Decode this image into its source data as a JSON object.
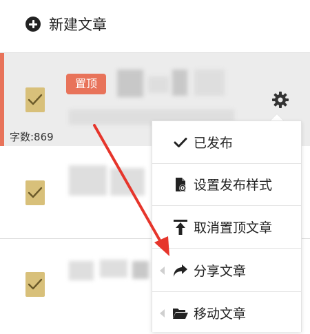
{
  "header": {
    "new_article_label": "新建文章"
  },
  "articles": [
    {
      "pinned_badge": "置顶",
      "word_count": "字数:869",
      "checked": true
    },
    {
      "checked": true
    },
    {
      "checked": true
    }
  ],
  "context_menu": {
    "items": [
      {
        "label": "已发布",
        "icon": "check-icon"
      },
      {
        "label": "设置发布样式",
        "icon": "file-settings-icon"
      },
      {
        "label": "取消置顶文章",
        "icon": "unpin-upload-icon"
      },
      {
        "label": "分享文章",
        "icon": "share-icon"
      },
      {
        "label": "移动文章",
        "icon": "folder-open-icon"
      }
    ]
  },
  "colors": {
    "accent": "#e8735a",
    "checkbox": "#d8c07a",
    "selected_row": "#ececec",
    "annotation_arrow": "#e6352b"
  }
}
